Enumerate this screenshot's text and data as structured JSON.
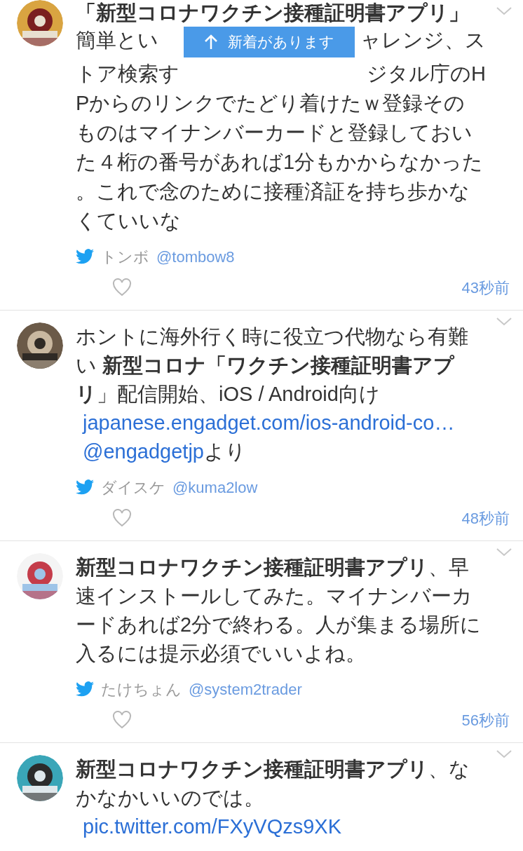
{
  "new_tweets_toast": {
    "label": "新着があります"
  },
  "tweets": [
    {
      "kind": "covered",
      "heading": "「新型コロナワクチン接種証明書アプリ」",
      "split_lines": [
        {
          "left": "簡単とい",
          "right": "ャレンジ、ス"
        },
        {
          "left": "トア検索す",
          "right": "ジタル庁のH"
        }
      ],
      "lines": [
        "Pからのリンクでたどり着けたｗ登録その",
        "ものはマイナンバーカードと登録しておい",
        "た４桁の番号があれば1分もかからなかった",
        "。これで念のために接種済証を持ち歩かな",
        "くていいな"
      ],
      "name": "トンボ",
      "handle": "@tombow8",
      "time": "43秒前"
    },
    {
      "kind": "flow",
      "segments": [
        {
          "kind": "text",
          "text": "ホントに海外行く時に役立つ代物なら有難い "
        },
        {
          "kind": "bold",
          "text": "新型コロナ「ワクチン接種証明書アプリ"
        },
        {
          "kind": "text",
          "text": "」配信開始、iOS / Android向け "
        },
        {
          "kind": "link",
          "text": "japanese.engadget.com/ios-android-co…"
        },
        {
          "kind": "link",
          "text": "@engadgetjp"
        },
        {
          "kind": "text",
          "text": "より"
        }
      ],
      "name": "ダイスケ",
      "handle": "@kuma2low",
      "time": "48秒前"
    },
    {
      "kind": "flow",
      "segments": [
        {
          "kind": "bold",
          "text": "新型コロナワクチン接種証明書アプリ"
        },
        {
          "kind": "text",
          "text": "、早速インストールしてみた。マイナンバーカードあれば2分で終わる。人が集まる場所に入るには提示必須でいいよね。"
        }
      ],
      "name": "たけちょん",
      "handle": "@system2trader",
      "time": "56秒前"
    },
    {
      "kind": "flow",
      "segments": [
        {
          "kind": "bold",
          "text": "新型コロナワクチン接種証明書アプリ"
        },
        {
          "kind": "text",
          "text": "、なかなかいいのでは。"
        },
        {
          "kind": "link",
          "text": "pic.twitter.com/FXyVQzs9XK"
        }
      ]
    }
  ]
}
